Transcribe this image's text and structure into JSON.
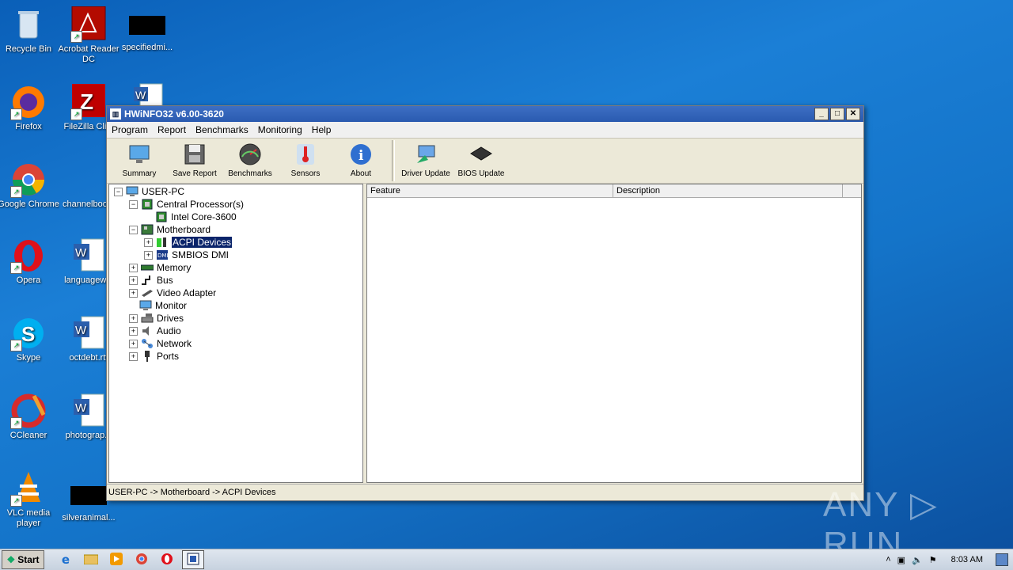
{
  "desktop": {
    "icons": [
      {
        "label": "Recycle Bin"
      },
      {
        "label": "Acrobat Reader DC"
      },
      {
        "label": "specifiedmi..."
      },
      {
        "label": "Firefox"
      },
      {
        "label": "FileZilla Cli..."
      },
      {
        "label": "Google Chrome"
      },
      {
        "label": "channelboo..."
      },
      {
        "label": "Opera"
      },
      {
        "label": "languagew..."
      },
      {
        "label": "Skype"
      },
      {
        "label": "octdebt.rtf"
      },
      {
        "label": "CCleaner"
      },
      {
        "label": "photograp..."
      },
      {
        "label": "VLC media player"
      },
      {
        "label": "silveranimal..."
      }
    ]
  },
  "window": {
    "title": "HWiNFO32 v6.00-3620",
    "menu": [
      "Program",
      "Report",
      "Benchmarks",
      "Monitoring",
      "Help"
    ],
    "toolbar": [
      "Summary",
      "Save Report",
      "Benchmarks",
      "Sensors",
      "About",
      "Driver Update",
      "BIOS Update"
    ],
    "tree": {
      "root": "USER-PC",
      "cpu": "Central Processor(s)",
      "cpu_child": "Intel Core-3600",
      "motherboard": "Motherboard",
      "acpi": "ACPI Devices",
      "smbios": "SMBIOS DMI",
      "memory": "Memory",
      "bus": "Bus",
      "video": "Video Adapter",
      "monitor": "Monitor",
      "drives": "Drives",
      "audio": "Audio",
      "network": "Network",
      "ports": "Ports"
    },
    "columns": [
      "Feature",
      "Description"
    ],
    "status": "USER-PC -> Motherboard -> ACPI Devices"
  },
  "taskbar": {
    "start": "Start",
    "clock": "8:03 AM"
  },
  "watermark": "ANY ▷ RUN"
}
